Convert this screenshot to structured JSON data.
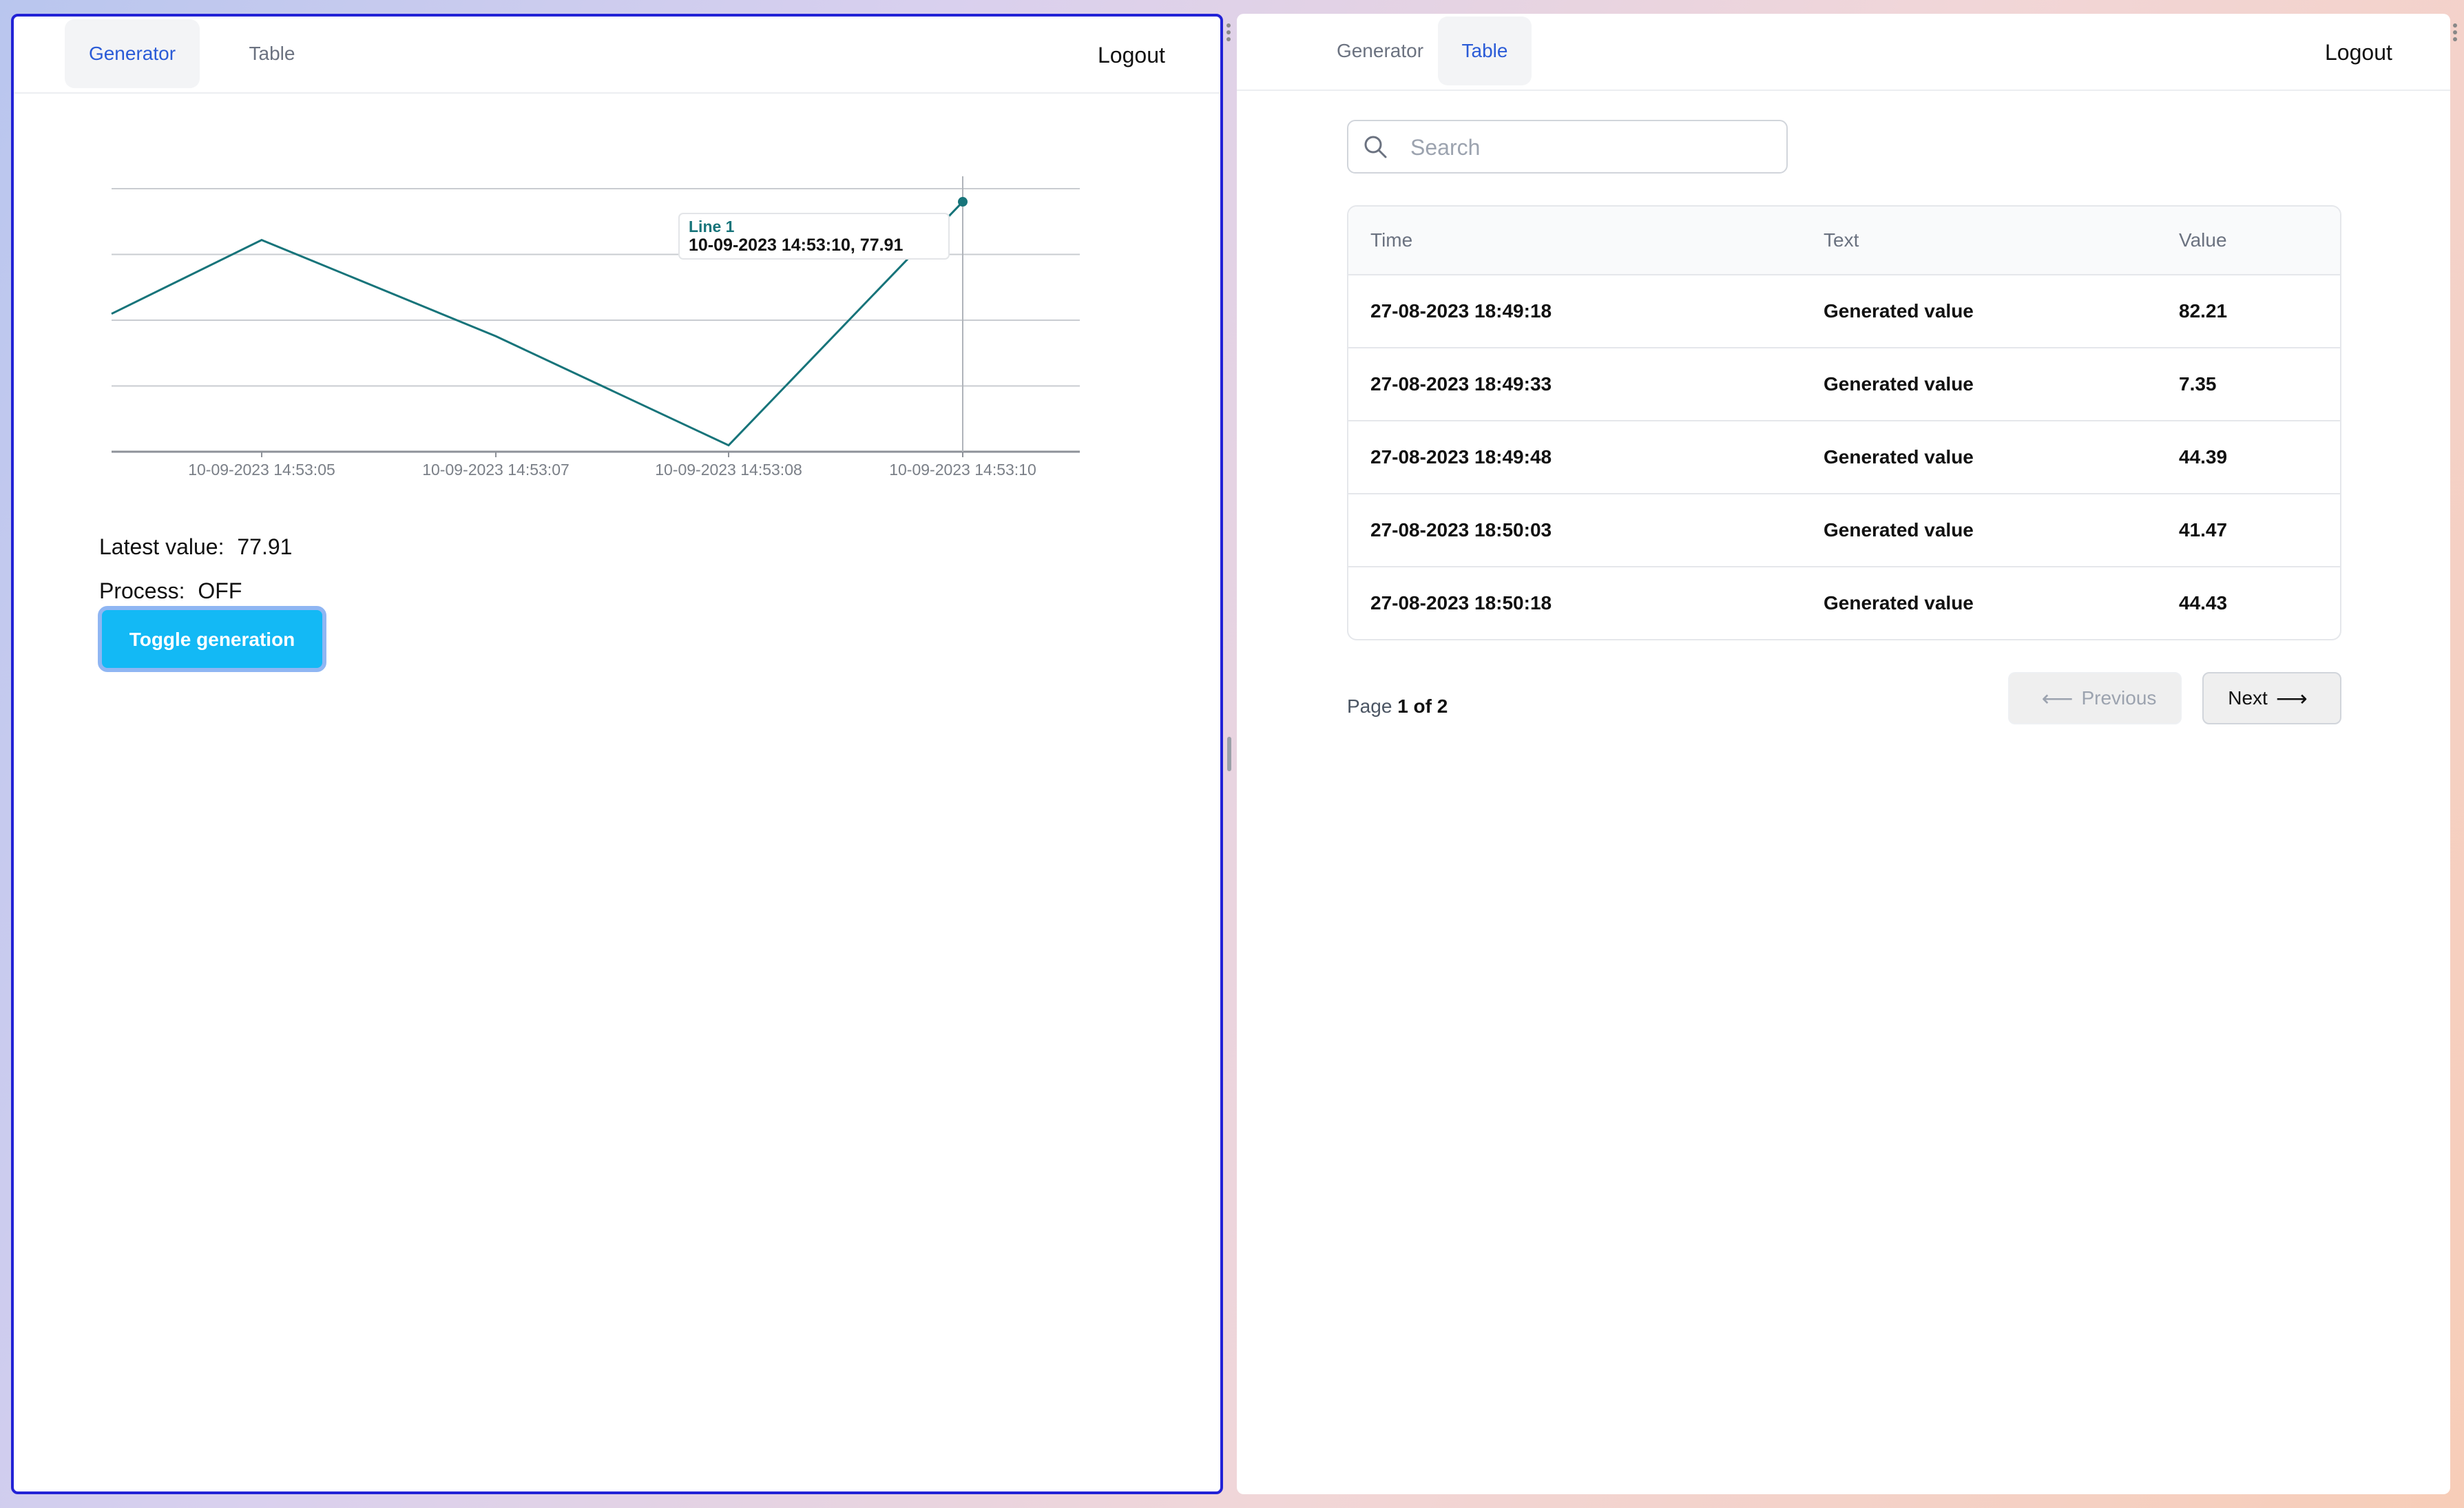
{
  "left_window": {
    "nav": {
      "tabs": [
        {
          "label": "Generator",
          "active": true
        },
        {
          "label": "Table",
          "active": false
        }
      ],
      "logout_label": "Logout"
    },
    "chart_data": {
      "type": "line",
      "x": [
        "10-09-2023 14:53:04",
        "10-09-2023 14:53:05",
        "10-09-2023 14:53:07",
        "10-09-2023 14:53:08",
        "10-09-2023 14:53:10"
      ],
      "tick_labels": [
        "10-09-2023 14:53:05",
        "10-09-2023 14:53:07",
        "10-09-2023 14:53:08",
        "10-09-2023 14:53:10"
      ],
      "series": [
        {
          "name": "Line 1",
          "values": [
            43,
            66,
            36,
            2,
            77.91
          ]
        }
      ],
      "ylim": [
        0,
        82
      ],
      "grid": true,
      "tooltip": {
        "series": "Line 1",
        "text": "10-09-2023 14:53:10, 77.91"
      },
      "line_color": "#17747a"
    },
    "latest_value_label": "Latest value:",
    "latest_value": "77.91",
    "process_label": "Process:",
    "process_value": "OFF",
    "toggle_button_label": "Toggle generation",
    "accent_color": "#13b9f5"
  },
  "right_window": {
    "nav": {
      "tabs": [
        {
          "label": "Generator",
          "active": false
        },
        {
          "label": "Table",
          "active": true
        }
      ],
      "logout_label": "Logout"
    },
    "search": {
      "placeholder": "Search",
      "value": ""
    },
    "table": {
      "headers": [
        "Time",
        "Text",
        "Value"
      ],
      "rows": [
        [
          "27-08-2023 18:49:18",
          "Generated value",
          "82.21"
        ],
        [
          "27-08-2023 18:49:33",
          "Generated value",
          "7.35"
        ],
        [
          "27-08-2023 18:49:48",
          "Generated value",
          "44.39"
        ],
        [
          "27-08-2023 18:50:03",
          "Generated value",
          "41.47"
        ],
        [
          "27-08-2023 18:50:18",
          "Generated value",
          "44.43"
        ]
      ]
    },
    "pagination": {
      "page_word": "Page",
      "current": "1",
      "of_word": "of",
      "total": "2",
      "previous_label": "Previous",
      "next_label": "Next"
    }
  }
}
